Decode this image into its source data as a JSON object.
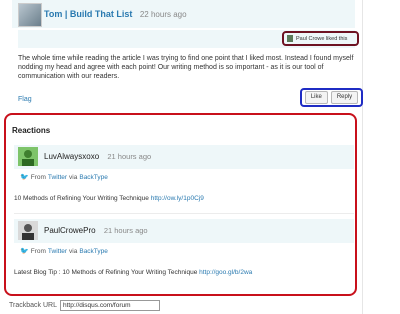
{
  "comment": {
    "author": "Tom | Build That List",
    "age": "22 hours ago",
    "liked_by": "Paul Crowe liked this",
    "body": "The whole time while reading the article I was trying to find one point that I liked most. Instead I found myself nodding my head and agree with each point! Our writing method is so important - as it is our tool of communication with our readers.",
    "flag": "Flag",
    "like_label": "Like",
    "reply_label": "Reply"
  },
  "reactions": {
    "title": "Reactions",
    "items": [
      {
        "name": "LuvAlwaysxoxo",
        "age": "21 hours ago",
        "from": "From",
        "source": "Twitter",
        "via": "via",
        "service": "BackType",
        "text": "10 Methods of Refining Your Writing Technique",
        "link": "http://ow.ly/1p0Cj9"
      },
      {
        "name": "PaulCrowePro",
        "age": "21 hours ago",
        "from": "From",
        "source": "Twitter",
        "via": "via",
        "service": "BackType",
        "text": "Latest Blog Tip : 10 Methods of Refining Your Writing Technique",
        "link": "http://goo.gl/b/2wa"
      }
    ]
  },
  "trackback": {
    "label": "Trackback URL",
    "value": "http://disqus.com/forum"
  }
}
